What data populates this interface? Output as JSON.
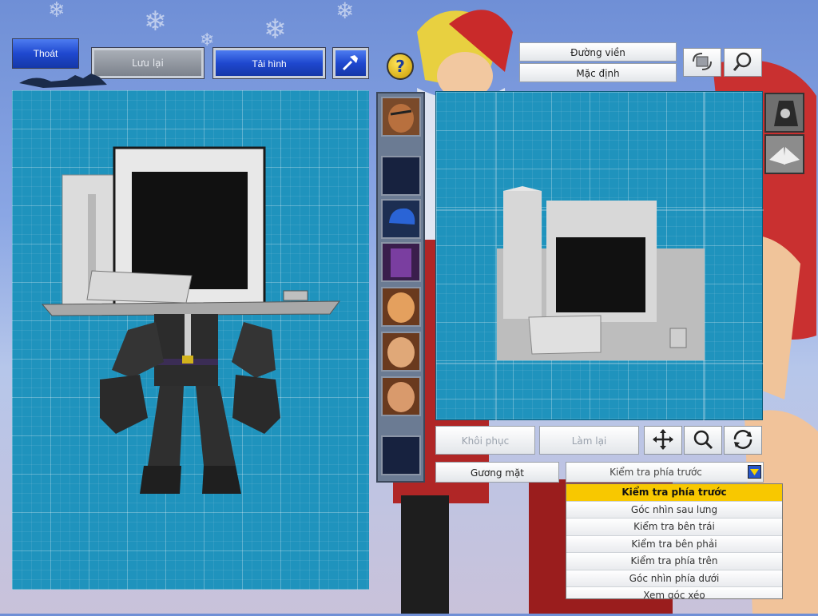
{
  "toolbar": {
    "exit_label": "Thoát",
    "save_label": "Lưu lại",
    "reload_label": "Tải hình",
    "hammer_icon": "hammer-icon",
    "help_icon": "question-icon"
  },
  "right_panel": {
    "border_label": "Đường viền",
    "default_label": "Mặc định",
    "restore_label": "Khôi phục",
    "redo_label": "Làm lại",
    "face_label": "Gương mặt"
  },
  "view_select": {
    "selected": "Kiểm tra phía trước",
    "options": [
      "Kiểm tra phía trước",
      "Góc nhìn sau lưng",
      "Kiểm tra bên trái",
      "Kiểm tra bên phải",
      "Kiểm tra phía trên",
      "Góc nhìn phía dưới",
      "Xem góc xéo"
    ]
  },
  "colors": {
    "grid_blue": "#1f93bd",
    "button_blue": "#1f48cf",
    "highlight_yellow": "#f8c800"
  }
}
